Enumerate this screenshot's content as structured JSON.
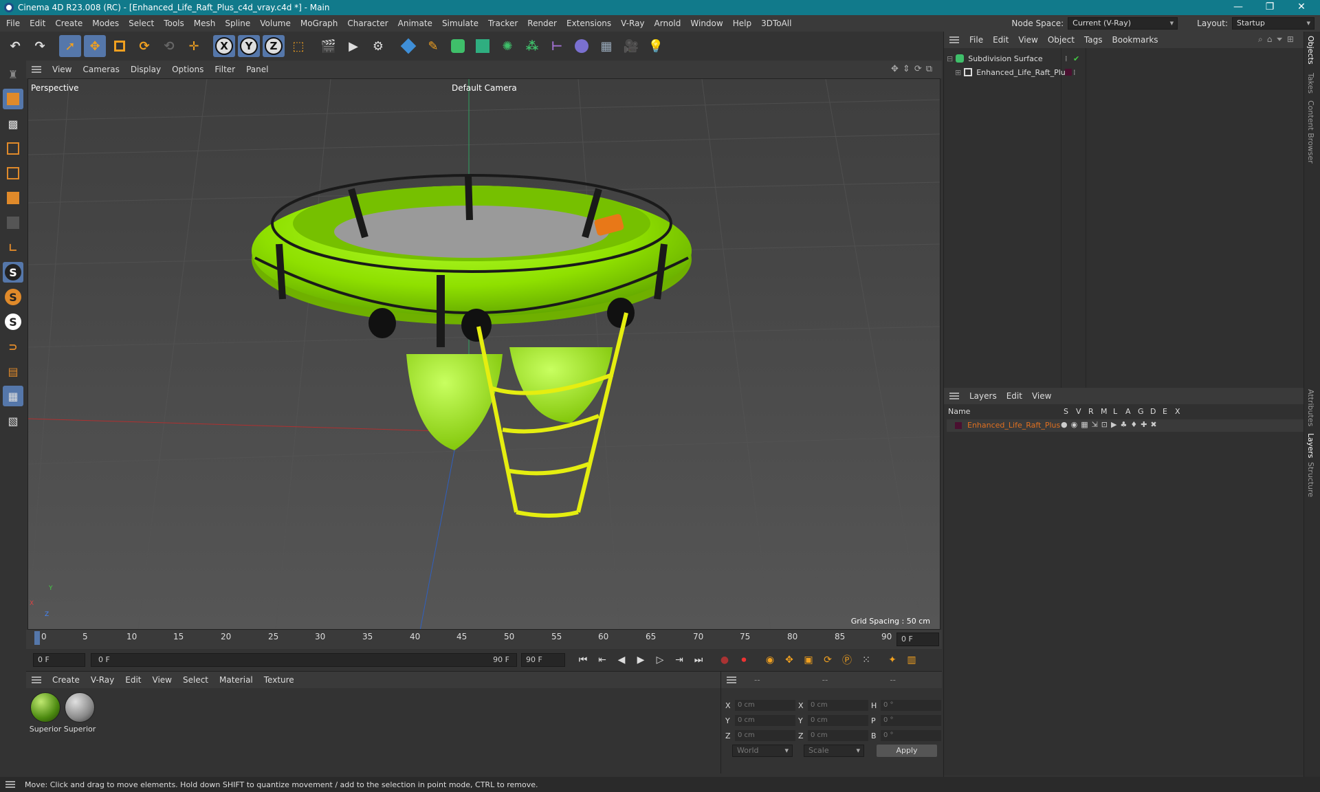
{
  "window": {
    "title": "Cinema 4D R23.008 (RC) - [Enhanced_Life_Raft_Plus_c4d_vray.c4d *] - Main",
    "minimize": "—",
    "restore": "❐",
    "close": "✕"
  },
  "menu": {
    "items": [
      "File",
      "Edit",
      "Create",
      "Modes",
      "Select",
      "Tools",
      "Mesh",
      "Spline",
      "Volume",
      "MoGraph",
      "Character",
      "Animate",
      "Simulate",
      "Tracker",
      "Render",
      "Extensions",
      "V-Ray",
      "Arnold",
      "Window",
      "Help",
      "3DToAll"
    ],
    "node_space_label": "Node Space:",
    "node_space_value": "Current (V-Ray)",
    "layout_label": "Layout:",
    "layout_value": "Startup"
  },
  "toolbar": {
    "axis_x": "X",
    "axis_y": "Y",
    "axis_z": "Z"
  },
  "leftbar": {
    "s1": "S",
    "s2": "S",
    "s3": "S"
  },
  "viewport": {
    "menu": [
      "View",
      "Cameras",
      "Display",
      "Options",
      "Filter",
      "Panel"
    ],
    "name": "Perspective",
    "camera": "Default Camera",
    "grid_spacing": "Grid Spacing : 50 cm",
    "axis_x": "X",
    "axis_y": "Y",
    "axis_z": "Z"
  },
  "timeline": {
    "ticks": [
      "0",
      "5",
      "10",
      "15",
      "20",
      "25",
      "30",
      "35",
      "40",
      "45",
      "50",
      "55",
      "60",
      "65",
      "70",
      "75",
      "80",
      "85",
      "90"
    ],
    "current_frame": "0 F",
    "start_field": "0 F",
    "range_start": "0 F",
    "range_end": "90 F",
    "end_field": "90 F"
  },
  "materials": {
    "menu": [
      "Create",
      "V-Ray",
      "Edit",
      "View",
      "Select",
      "Material",
      "Texture"
    ],
    "items": [
      {
        "name": "Superior"
      },
      {
        "name": "Superior"
      }
    ]
  },
  "coords": {
    "header": [
      "--",
      "--",
      "--"
    ],
    "rows": [
      {
        "a": "X",
        "av": "0 cm",
        "b": "X",
        "bv": "0 cm",
        "c": "H",
        "cv": "0 °"
      },
      {
        "a": "Y",
        "av": "0 cm",
        "b": "Y",
        "bv": "0 cm",
        "c": "P",
        "cv": "0 °"
      },
      {
        "a": "Z",
        "av": "0 cm",
        "b": "Z",
        "bv": "0 cm",
        "c": "B",
        "cv": "0 °"
      }
    ],
    "world": "World",
    "scale": "Scale",
    "apply": "Apply"
  },
  "objects": {
    "menu": [
      "File",
      "Edit",
      "View",
      "Object",
      "Tags",
      "Bookmarks"
    ],
    "rows": [
      {
        "name": "Subdivision Surface"
      },
      {
        "name": "Enhanced_Life_Raft_Plus"
      }
    ]
  },
  "layers": {
    "menu": [
      "Layers",
      "Edit",
      "View"
    ],
    "col_name": "Name",
    "cols": [
      "S",
      "V",
      "R",
      "M",
      "L",
      "A",
      "G",
      "D",
      "E",
      "X"
    ],
    "rows": [
      {
        "name": "Enhanced_Life_Raft_Plus"
      }
    ]
  },
  "tabs": [
    "Objects",
    "Takes",
    "Content Browser",
    "Attributes",
    "Layers",
    "Structure"
  ],
  "status": "Move: Click and drag to move elements. Hold down SHIFT to quantize movement / add to the selection in point mode, CTRL to remove.",
  "colors": {
    "title_bar": "#117a8b",
    "active_tool": "#5577aa",
    "raft": "#8fe000",
    "layer_name": "#e07020"
  }
}
